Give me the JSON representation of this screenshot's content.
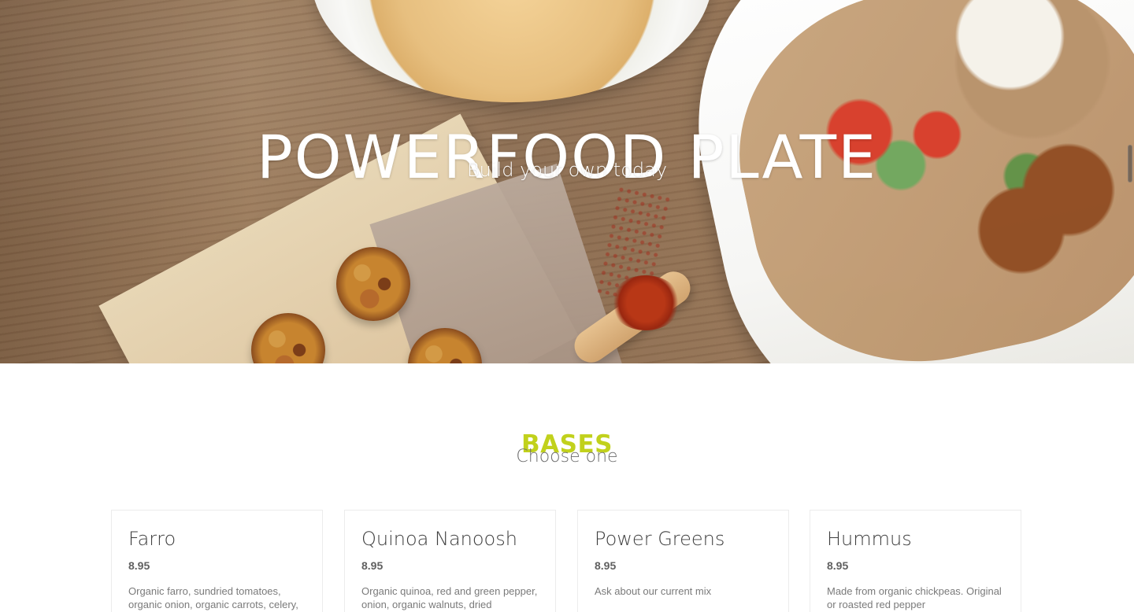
{
  "hero": {
    "title": "POWERFOOD PLATE",
    "subtitle": "Build your own today"
  },
  "section": {
    "title": "BASES",
    "subtitle": "Choose one"
  },
  "cards": [
    {
      "name": "Farro",
      "price": "8.95",
      "description": "Organic farro, sundried tomatoes, organic onion, organic carrots, celery,"
    },
    {
      "name": "Quinoa Nanoosh",
      "price": "8.95",
      "description": "Organic quinoa, red and green pepper, onion, organic walnuts, dried"
    },
    {
      "name": "Power Greens",
      "price": "8.95",
      "description": "Ask about our current mix"
    },
    {
      "name": "Hummus",
      "price": "8.95",
      "description": "Made from organic chickpeas. Original or roasted red pepper"
    }
  ],
  "colors": {
    "accent": "#c1d11c",
    "title_text": "#ffffff",
    "body_text": "#6e6e6e"
  },
  "icons": {
    "scrollbar": "scrollbar-thumb-icon"
  }
}
